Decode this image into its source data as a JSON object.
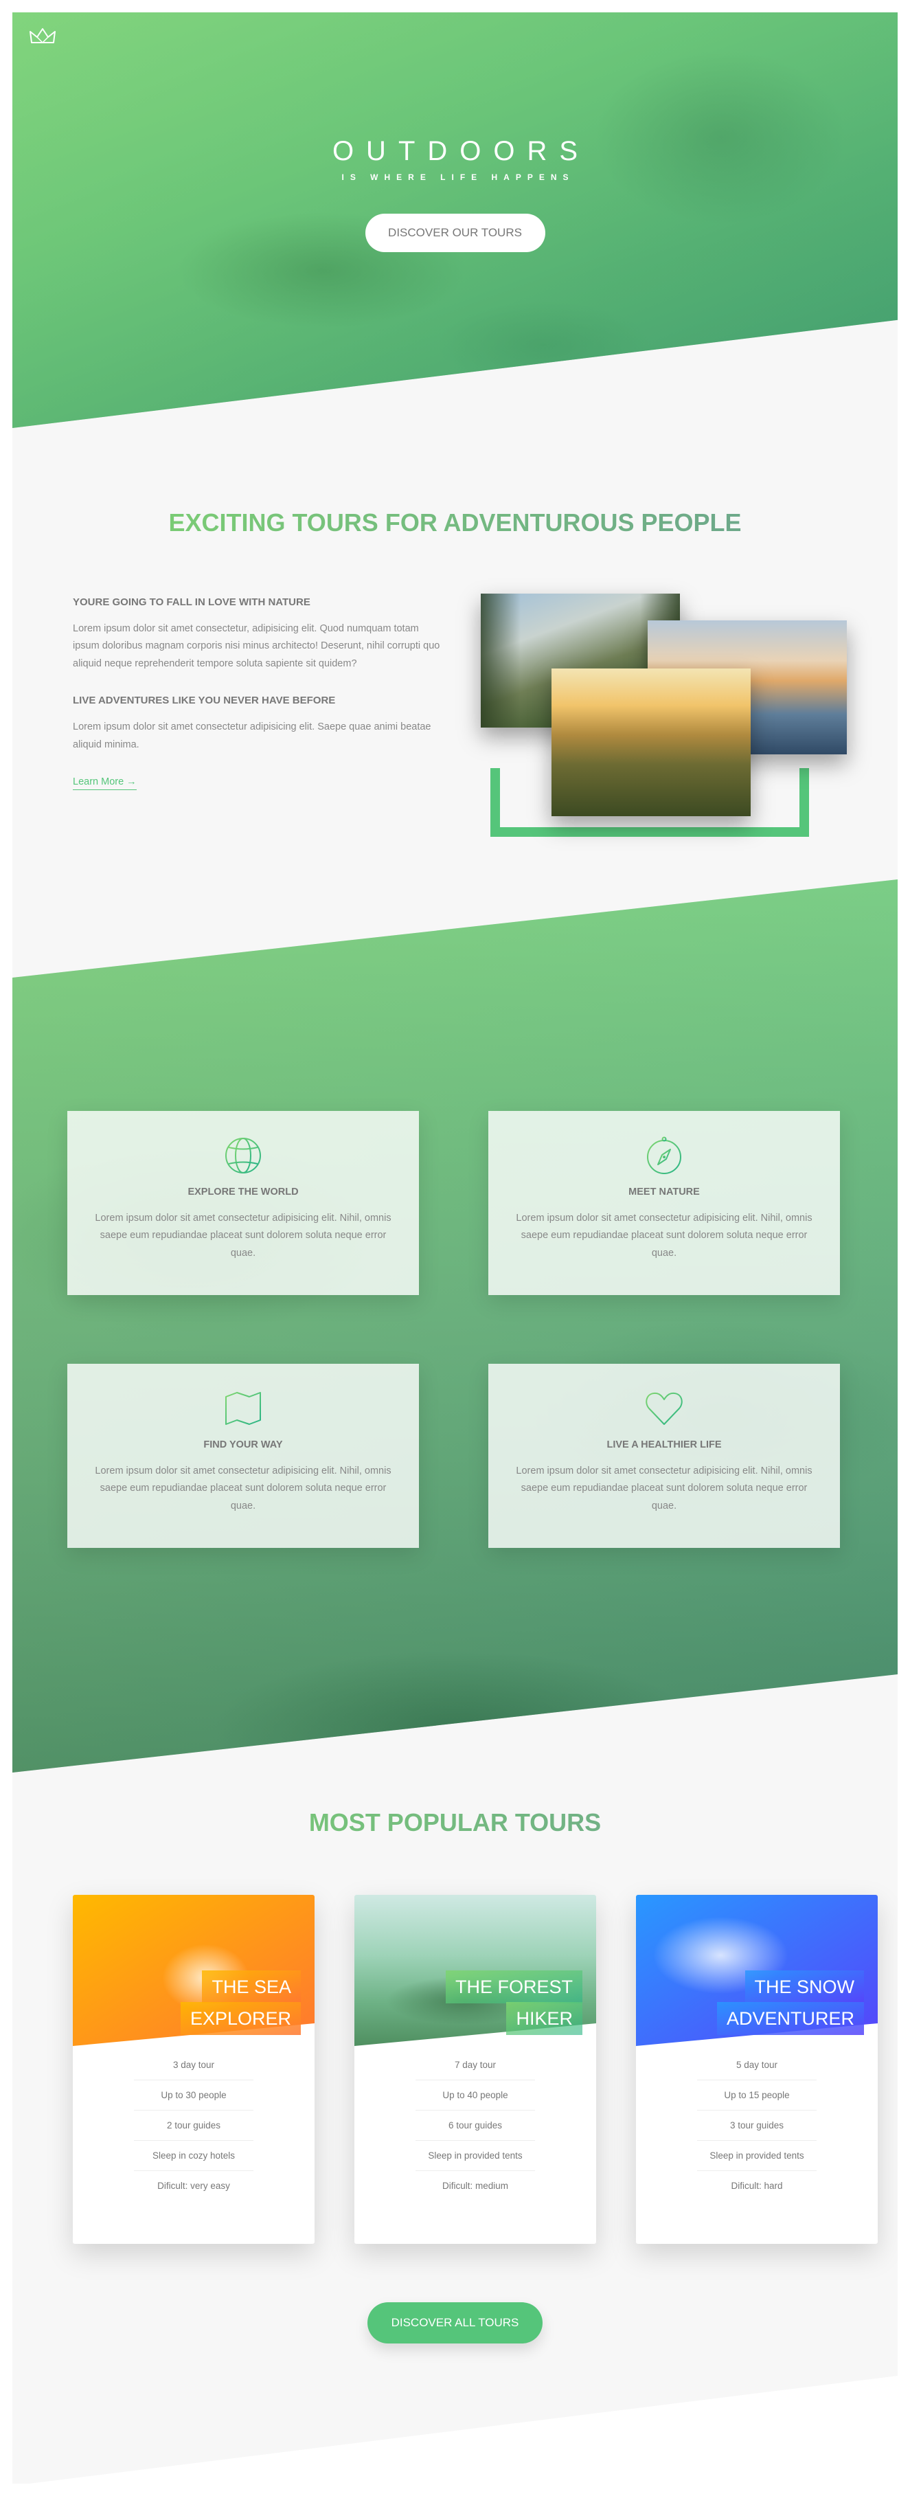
{
  "header": {
    "brand_main": "OUTDOORS",
    "brand_sub": "IS WHERE LIFE HAPPENS",
    "cta": "DISCOVER OUR TOURS"
  },
  "about": {
    "heading": "EXCITING TOURS FOR ADVENTUROUS PEOPLE",
    "block1_title": "YOURE GOING TO FALL IN LOVE WITH NATURE",
    "block1_text": "Lorem ipsum dolor sit amet consectetur, adipisicing elit. Quod numquam totam ipsum doloribus magnam corporis nisi minus architecto! Deserunt, nihil corrupti quo aliquid neque reprehenderit tempore soluta sapiente sit quidem?",
    "block2_title": "LIVE ADVENTURES LIKE YOU NEVER HAVE BEFORE",
    "block2_text": "Lorem ipsum dolor sit amet consectetur adipisicing elit. Saepe quae animi beatae aliquid minima.",
    "learn_more": "Learn More →"
  },
  "features": [
    {
      "icon": "globe-icon",
      "title": "EXPLORE THE WORLD",
      "text": "Lorem ipsum dolor sit amet consectetur adipisicing elit. Nihil, omnis saepe eum repudiandae placeat sunt dolorem soluta neque error quae."
    },
    {
      "icon": "compass-icon",
      "title": "MEET NATURE",
      "text": "Lorem ipsum dolor sit amet consectetur adipisicing elit. Nihil, omnis saepe eum repudiandae placeat sunt dolorem soluta neque error quae."
    },
    {
      "icon": "map-icon",
      "title": "FIND YOUR WAY",
      "text": "Lorem ipsum dolor sit amet consectetur adipisicing elit. Nihil, omnis saepe eum repudiandae placeat sunt dolorem soluta neque error quae."
    },
    {
      "icon": "heart-icon",
      "title": "LIVE A HEALTHIER LIFE",
      "text": "Lorem ipsum dolor sit amet consectetur adipisicing elit. Nihil, omnis saepe eum repudiandae placeat sunt dolorem soluta neque error quae."
    }
  ],
  "tours": {
    "heading": "MOST POPULAR TOURS",
    "cards": [
      {
        "title_1": "THE SEA",
        "title_2": "EXPLORER",
        "details": [
          "3 day tour",
          "Up to 30 people",
          "2 tour guides",
          "Sleep in cozy hotels",
          "Dificult: very easy"
        ]
      },
      {
        "title_1": "THE FOREST",
        "title_2": "HIKER",
        "details": [
          "7 day tour",
          "Up to 40 people",
          "6 tour guides",
          "Sleep in provided tents",
          "Dificult: medium"
        ]
      },
      {
        "title_1": "THE SNOW",
        "title_2": "ADVENTURER",
        "details": [
          "5 day tour",
          "Up to 15 people",
          "3 tour guides",
          "Sleep in provided tents",
          "Dificult: hard"
        ]
      }
    ],
    "cta": "DISCOVER ALL TOURS"
  },
  "colors": {
    "primary": "#55c57a",
    "primary_light": "#7ed56f",
    "primary_dark": "#28b485",
    "orange_light": "#ffb900",
    "orange_dark": "#ff7730",
    "blue_light": "#2998ff",
    "blue_dark": "#5643fa",
    "text": "#777777",
    "background": "#f7f7f7"
  }
}
